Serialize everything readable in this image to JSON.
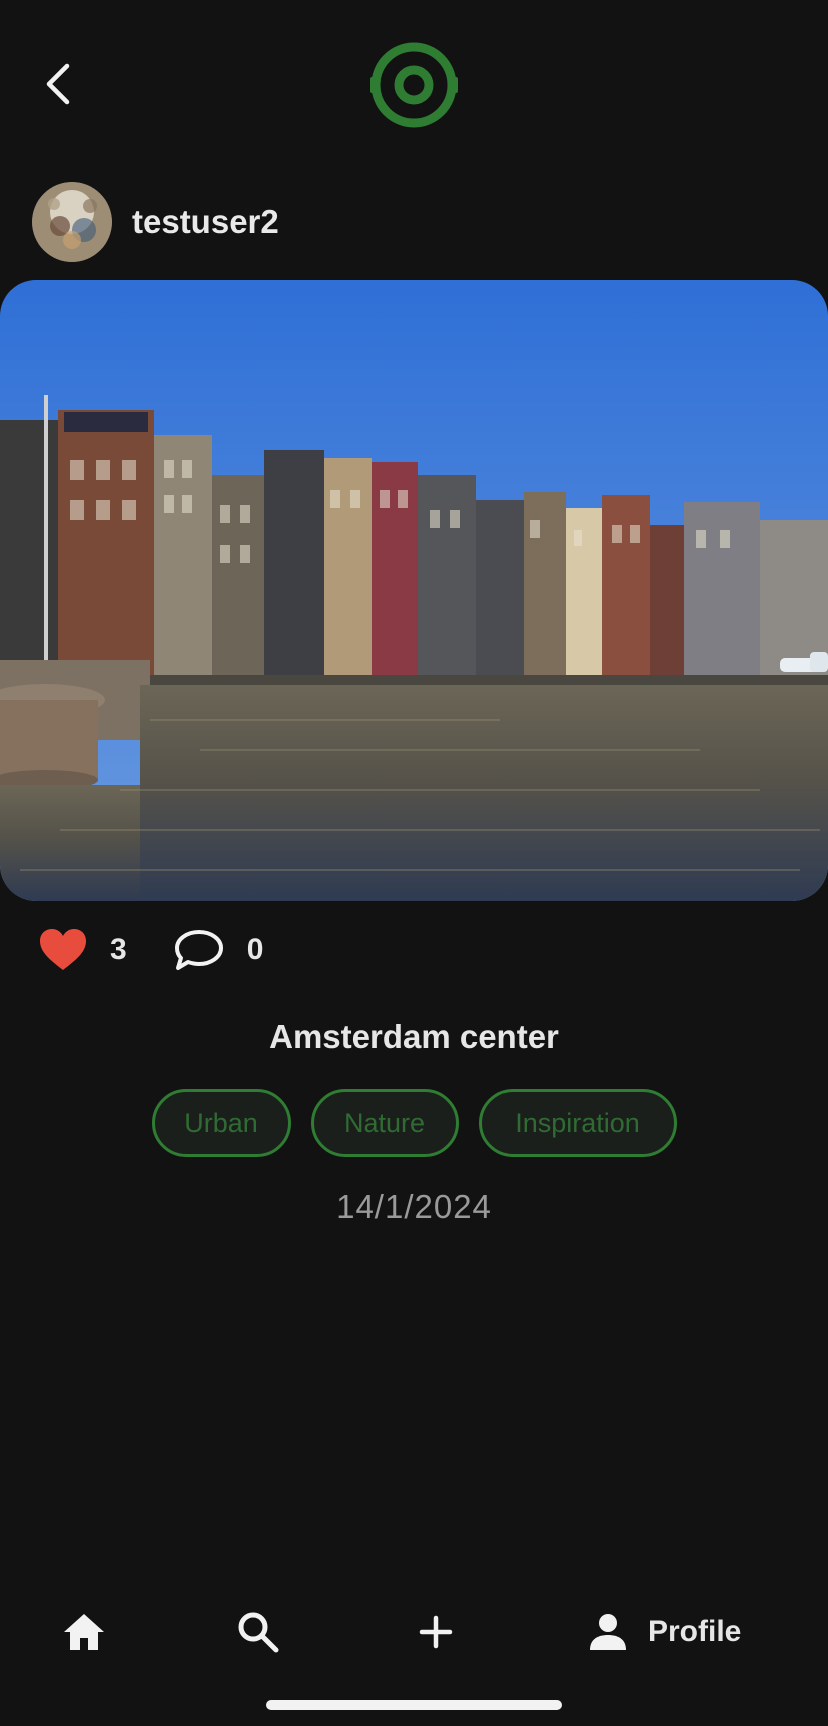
{
  "header": {
    "back_icon": "chevron-left-icon",
    "logo_icon": "target-logo-icon",
    "logo_color": "#2e7d32"
  },
  "post": {
    "author": {
      "username": "testuser2",
      "avatar_icon": "avatar-image"
    },
    "photo": {
      "description_icon": "canal-houses-photo"
    },
    "likes": {
      "count": "3",
      "icon": "heart-icon",
      "color": "#e74c3c"
    },
    "comments": {
      "count": "0",
      "icon": "comment-icon"
    },
    "caption": "Amsterdam center",
    "tags": [
      "Urban",
      "Nature",
      "Inspiration"
    ],
    "date": "14/1/2024"
  },
  "bottom_nav": {
    "items": [
      {
        "icon": "home-icon",
        "label": ""
      },
      {
        "icon": "search-icon",
        "label": ""
      },
      {
        "icon": "plus-icon",
        "label": ""
      },
      {
        "icon": "profile-icon",
        "label": "Profile"
      }
    ]
  },
  "colors": {
    "background": "#121212",
    "accent_green": "#2e7d32",
    "tag_text": "#2f6b33",
    "date_text": "#9a9a9a"
  }
}
